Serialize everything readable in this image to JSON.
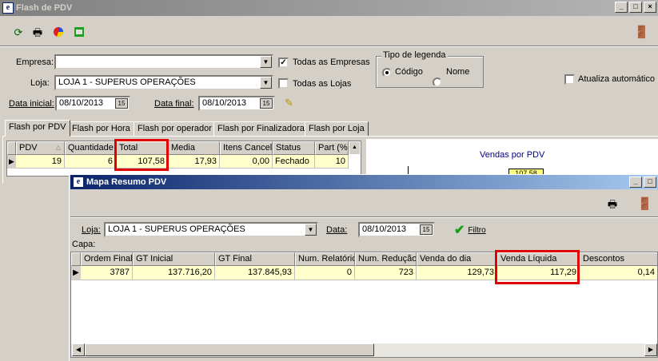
{
  "main": {
    "title": "Flash de PDV",
    "toolbar_icons": [
      "refresh-icon",
      "print-icon",
      "chart-icon",
      "export-icon"
    ],
    "exit_icon": "exit-door-icon",
    "empresa_label": "Empresa:",
    "empresa_value": "",
    "todas_empresas_label": "Todas as Empresas",
    "todas_empresas_checked": true,
    "loja_label": "Loja:",
    "loja_value": "LOJA 1 - SUPERUS OPERAÇÕES",
    "todas_lojas_label": "Todas as Lojas",
    "todas_lojas_checked": false,
    "data_inicial_label": "Data inicial:",
    "data_inicial_value": "08/10/2013",
    "data_final_label": "Data final:",
    "data_final_value": "08/10/2013",
    "legend_group_label": "Tipo de legenda",
    "legend_codigo": "Código",
    "legend_nome": "Nome",
    "legend_selected": "Código",
    "atualiza_label": "Atualiza automático",
    "atualiza_checked": false,
    "tabs": [
      "Flash por PDV",
      "Flash por Hora",
      "Flash por operador",
      "Flash por Finalizadora",
      "Flash por Loja"
    ],
    "selected_tab": "Flash por PDV",
    "grid_headers": [
      "PDV",
      "Quantidade",
      "Total",
      "Media",
      "Itens Cancel",
      "Status",
      "Part (%)"
    ],
    "grid_row": [
      "19",
      "6",
      "107,58",
      "17,93",
      "0,00",
      "Fechado",
      "10"
    ],
    "chart_title": "Vendas por PDV",
    "chart_bar_label": "107,58"
  },
  "dialog": {
    "title": "Mapa Resumo PDV",
    "loja_label": "Loja:",
    "loja_value": "LOJA 1 - SUPERUS OPERAÇÕES",
    "data_label": "Data:",
    "data_value": "08/10/2013",
    "filtro_label": "Filtro",
    "capa_label": "Capa:",
    "grid_headers": [
      "Ordem Final",
      "GT Inicial",
      "GT Final",
      "Num. Relatório",
      "Num. Redução",
      "Venda do dia",
      "Venda Líquida",
      "Descontos"
    ],
    "grid_row": [
      "3787",
      "137.716,20",
      "137.845,93",
      "0",
      "723",
      "129,73",
      "117,29",
      "0,14"
    ]
  }
}
